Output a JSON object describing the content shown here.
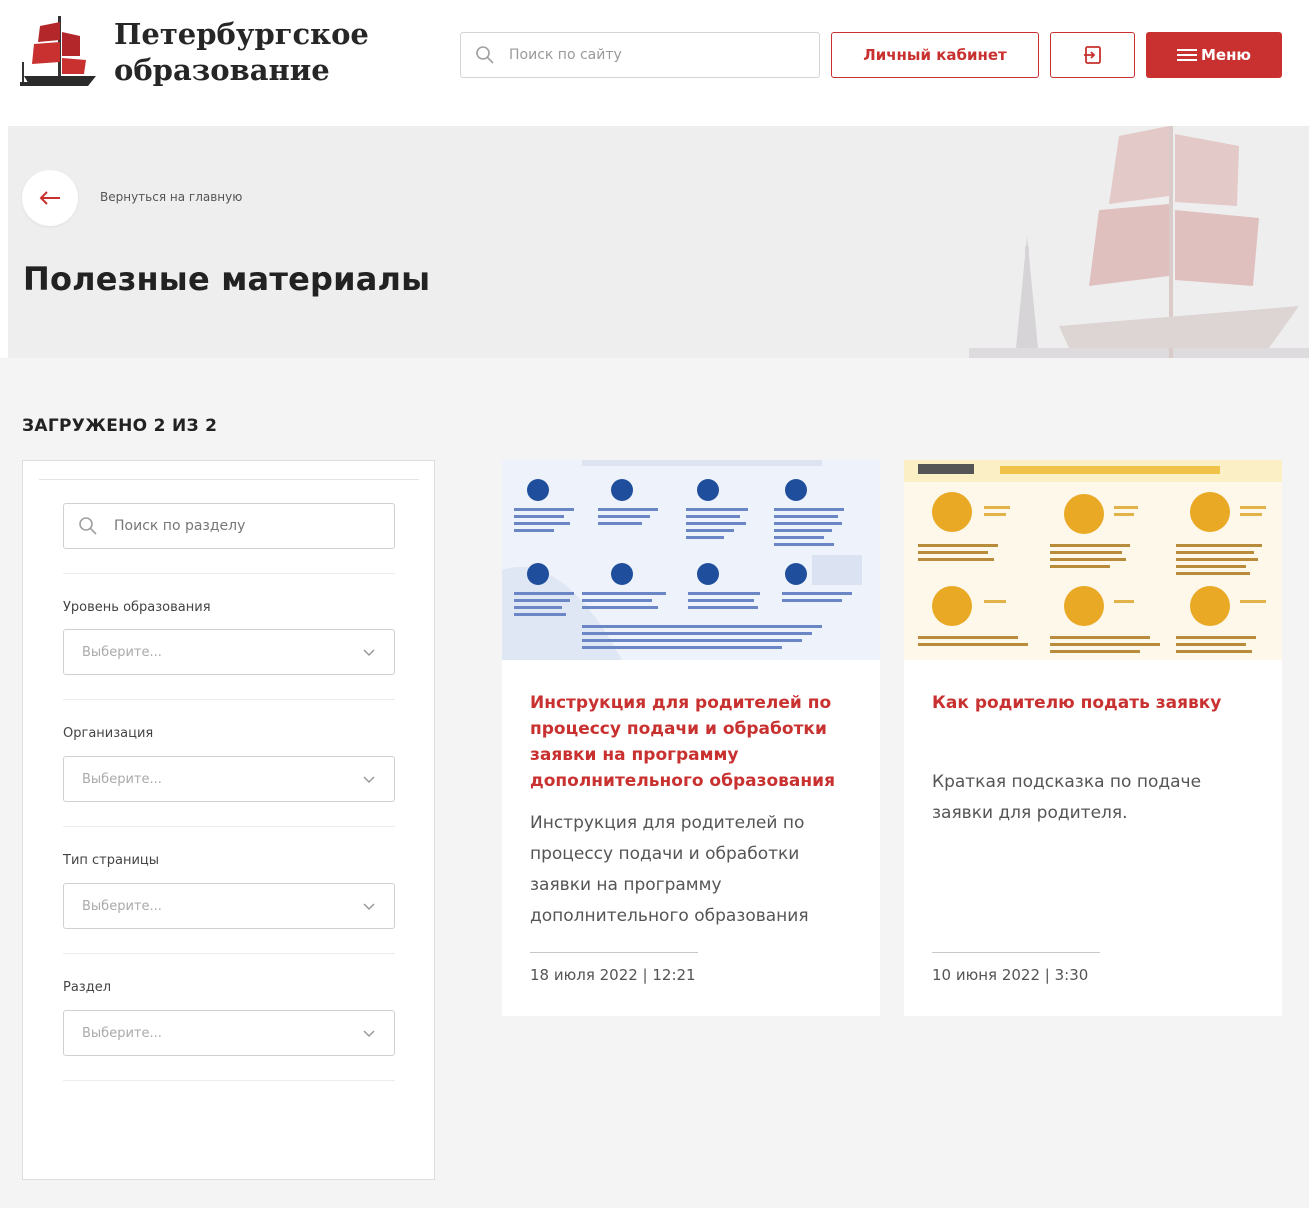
{
  "header": {
    "logo_line1": "Петербургское",
    "logo_line2": "образование",
    "search_placeholder": "Поиск по сайту",
    "cabinet_label": "Личный кабинет",
    "login_icon": "login-arrow-icon",
    "menu_label": "Меню",
    "menu_icon": "hamburger-icon"
  },
  "hero": {
    "back_label": "Вернуться на главную",
    "title": "Полезные материалы"
  },
  "list": {
    "loaded_text": "ЗАГРУЖЕНО 2 ИЗ 2"
  },
  "filters": {
    "search_placeholder": "Поиск по разделу",
    "items": [
      {
        "label": "Уровень образования",
        "placeholder": "Выберите..."
      },
      {
        "label": "Организация",
        "placeholder": "Выберите..."
      },
      {
        "label": "Тип страницы",
        "placeholder": "Выберите..."
      },
      {
        "label": "Раздел",
        "placeholder": "Выберите..."
      }
    ]
  },
  "cards": [
    {
      "title": "Инструкция для родителей по процессу подачи и обработки заявки на программу дополнительного образования",
      "description": "Инструкция для родителей по процессу подачи и обработки заявки на программу дополнительного образования",
      "date": "18 июля 2022 | 12:21"
    },
    {
      "title": "Как родителю подать заявку",
      "description": "Краткая подсказка по подаче заявки для родителя.",
      "date": "10 июня 2022 | 3:30"
    }
  ],
  "colors": {
    "accent": "#c8312f",
    "hero_bg": "#efeeef",
    "content_bg": "#f4f4f4"
  }
}
